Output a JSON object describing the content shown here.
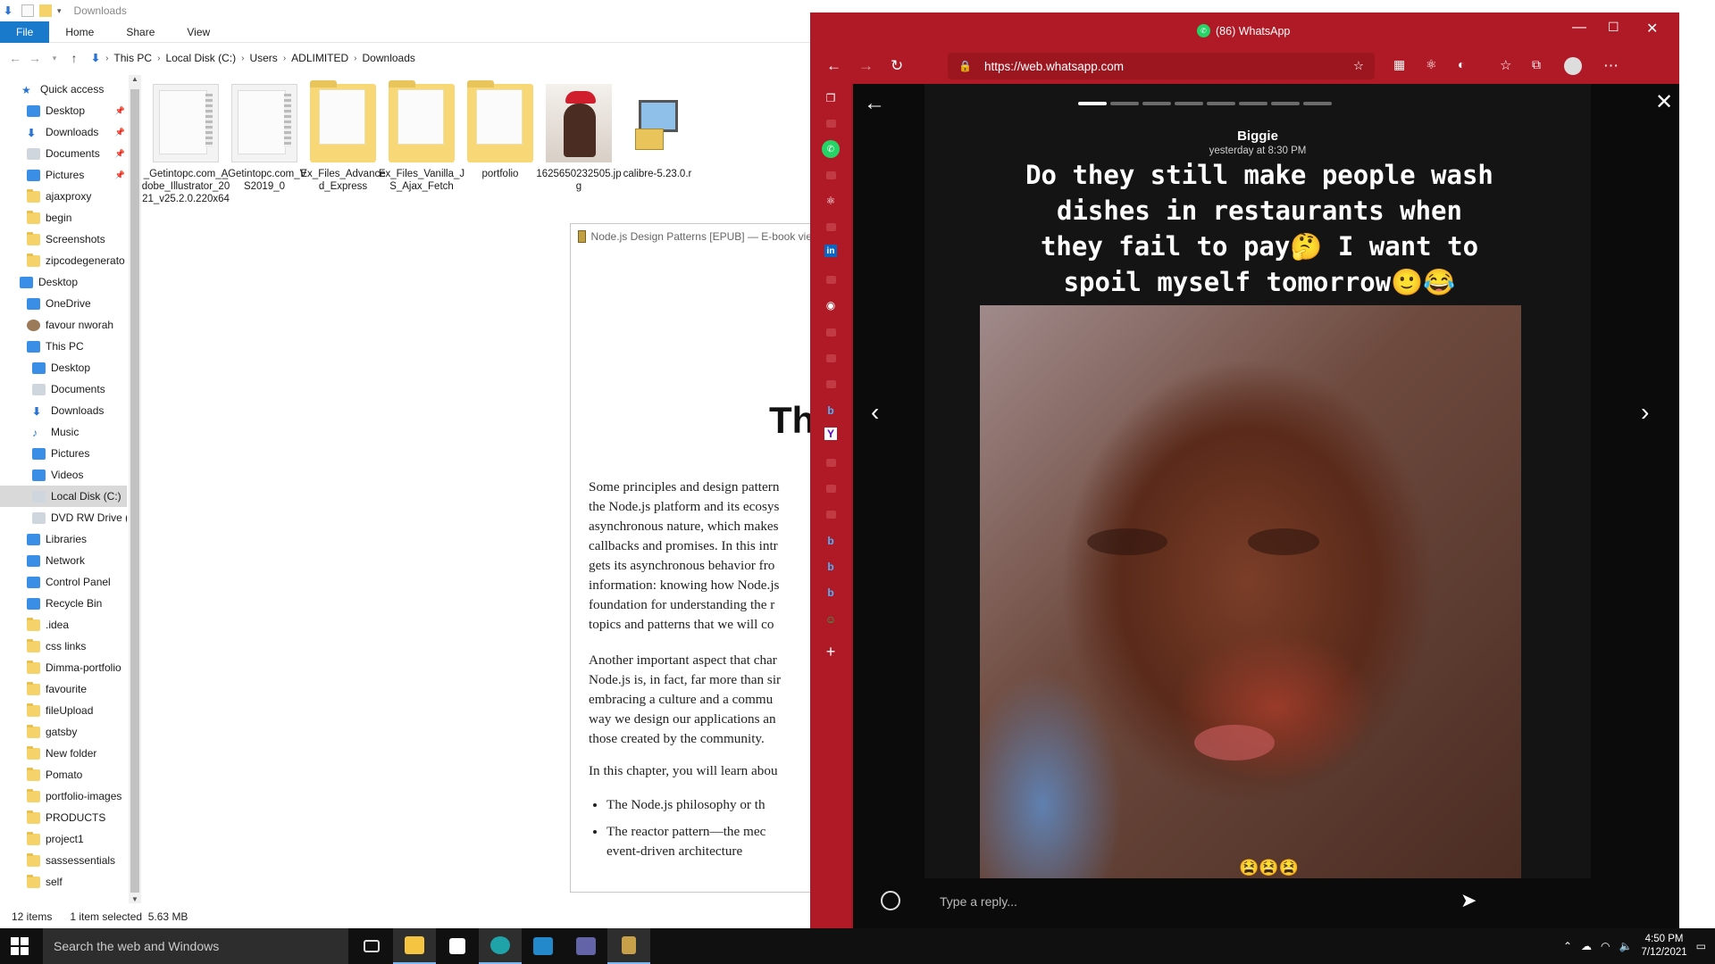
{
  "explorer": {
    "window_title": "Downloads",
    "ribbon_tabs": [
      "File",
      "Home",
      "Share",
      "View"
    ],
    "breadcrumb": [
      "This PC",
      "Local Disk (C:)",
      "Users",
      "ADLIMITED",
      "Downloads"
    ],
    "nav": [
      {
        "label": "Quick access",
        "icon": "star-icon",
        "pinned": false
      },
      {
        "label": "Desktop",
        "icon": "desktop-icon",
        "pinned": true
      },
      {
        "label": "Downloads",
        "icon": "download-icon",
        "pinned": true
      },
      {
        "label": "Documents",
        "icon": "documents-icon",
        "pinned": true
      },
      {
        "label": "Pictures",
        "icon": "pictures-icon",
        "pinned": true
      },
      {
        "label": "ajaxproxy",
        "icon": "folder-icon",
        "pinned": false
      },
      {
        "label": "begin",
        "icon": "folder-icon",
        "pinned": false
      },
      {
        "label": "Screenshots",
        "icon": "folder-icon",
        "pinned": false
      },
      {
        "label": "zipcodegenerato",
        "icon": "folder-icon",
        "pinned": false
      },
      {
        "label": "Desktop",
        "icon": "desktop-icon",
        "pinned": false
      },
      {
        "label": "OneDrive",
        "icon": "cloud-icon",
        "pinned": false
      },
      {
        "label": "favour nworah",
        "icon": "user-icon",
        "pinned": false
      },
      {
        "label": "This PC",
        "icon": "computer-icon",
        "pinned": false
      },
      {
        "label": "Desktop",
        "icon": "desktop-icon",
        "pinned": false
      },
      {
        "label": "Documents",
        "icon": "documents-icon",
        "pinned": false
      },
      {
        "label": "Downloads",
        "icon": "download-icon",
        "pinned": false
      },
      {
        "label": "Music",
        "icon": "music-icon",
        "pinned": false
      },
      {
        "label": "Pictures",
        "icon": "pictures-icon",
        "pinned": false
      },
      {
        "label": "Videos",
        "icon": "videos-icon",
        "pinned": false
      },
      {
        "label": "Local Disk (C:)",
        "icon": "drive-icon",
        "pinned": false
      },
      {
        "label": "DVD RW Drive (",
        "icon": "dvd-icon",
        "pinned": false
      },
      {
        "label": "Libraries",
        "icon": "libraries-icon",
        "pinned": false
      },
      {
        "label": "Network",
        "icon": "network-icon",
        "pinned": false
      },
      {
        "label": "Control Panel",
        "icon": "control-panel-icon",
        "pinned": false
      },
      {
        "label": "Recycle Bin",
        "icon": "recycle-bin-icon",
        "pinned": false
      },
      {
        "label": ".idea",
        "icon": "folder-icon",
        "pinned": false
      },
      {
        "label": "css links",
        "icon": "folder-icon",
        "pinned": false
      },
      {
        "label": "Dimma-portfolio",
        "icon": "folder-icon",
        "pinned": false
      },
      {
        "label": "favourite",
        "icon": "folder-icon",
        "pinned": false
      },
      {
        "label": "fileUpload",
        "icon": "folder-icon",
        "pinned": false
      },
      {
        "label": "gatsby",
        "icon": "folder-icon",
        "pinned": false
      },
      {
        "label": "New folder",
        "icon": "folder-icon",
        "pinned": false
      },
      {
        "label": "Pomato",
        "icon": "folder-icon",
        "pinned": false
      },
      {
        "label": "portfolio-images",
        "icon": "folder-icon",
        "pinned": false
      },
      {
        "label": "PRODUCTS",
        "icon": "folder-icon",
        "pinned": false
      },
      {
        "label": "project1",
        "icon": "folder-icon",
        "pinned": false
      },
      {
        "label": "sassessentials",
        "icon": "folder-icon",
        "pinned": false
      },
      {
        "label": "self",
        "icon": "folder-icon",
        "pinned": false
      }
    ],
    "selected_nav": "Local Disk (C:)",
    "files": [
      {
        "name": "_Getintopc.com_Adobe_Illustrator_2021_v25.2.0.220x64",
        "type": "zip"
      },
      {
        "name": "_Getintopc.com_VS2019_0",
        "type": "zip"
      },
      {
        "name": "Ex_Files_Advanced_Express",
        "type": "folder"
      },
      {
        "name": "Ex_Files_Vanilla_JS_Ajax_Fetch",
        "type": "folder"
      },
      {
        "name": "portfolio",
        "type": "folder"
      },
      {
        "name": "1625650232505.jpg",
        "type": "photo"
      },
      {
        "name": "calibre-5.23.0.r",
        "type": "exe"
      }
    ],
    "status": {
      "items": "12 items",
      "selected": "1 item selected",
      "size": "5.63 MB"
    }
  },
  "ebook": {
    "title": "Node.js Design Patterns [EPUB] — E-book vie",
    "heading": "Th",
    "paragraph1": [
      "Some principles and design pattern",
      "the Node.js platform and its ecosys",
      "asynchronous nature, which makes",
      "callbacks and promises. In this intr",
      "gets its asynchronous behavior fro",
      "information: knowing how Node.js",
      "foundation for understanding the r",
      "topics and patterns that we will co"
    ],
    "paragraph2": [
      "Another important aspect that char",
      "Node.js is, in fact, far more than sir",
      "embracing a culture and a commu",
      "way we design our applications an",
      "those created by the community."
    ],
    "paragraph3": "In this chapter, you will learn abou",
    "bullets": [
      "The Node.js philosophy or th",
      "The reactor pattern—the mec",
      "event-driven architecture"
    ]
  },
  "browser": {
    "window_title": "(86) WhatsApp",
    "url": "https://web.whatsapp.com",
    "accent": "#b01a26",
    "sidebar_icons": [
      "tab-actions-icon",
      "youtube-icon",
      "whatsapp-icon",
      "generic-icon",
      "react-icon",
      "generic-icon",
      "linkedin-icon",
      "youtube-icon",
      "github-icon",
      "youtube-icon",
      "youtube-icon",
      "youtube-icon",
      "bing-icon",
      "yahoo-icon",
      "generic-icon",
      "generic-icon",
      "generic-icon",
      "bing-icon",
      "bing-icon",
      "bing-icon",
      "alien-icon",
      "add-icon"
    ],
    "story": {
      "segments_total": 8,
      "segments_viewed": 1,
      "name": "Biggie",
      "time": "yesterday at 8:30 PM",
      "caption_lines": [
        "Do they still make people wash",
        "dishes in restaurants when",
        "they fail to pay🤔 I want to",
        "spoil myself tomorrow🙂😂"
      ],
      "photo_emojis": "😫😫😫",
      "reply_placeholder": "Type a reply..."
    }
  },
  "taskbar": {
    "search_placeholder": "Search the web and Windows",
    "apps": [
      "task-view-icon",
      "file-explorer-icon",
      "store-icon",
      "edge-icon",
      "vscode-icon",
      "teams-icon",
      "calibre-icon"
    ],
    "time": "4:50 PM",
    "date": "7/12/2021"
  }
}
